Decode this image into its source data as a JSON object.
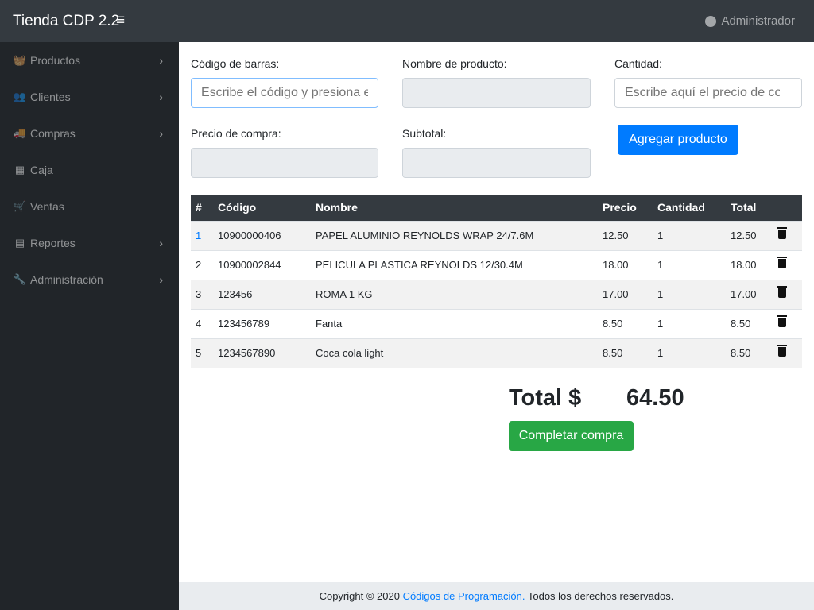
{
  "navbar": {
    "brand": "Tienda CDP 2.2",
    "menu_icon": "≡",
    "user": "Administrador"
  },
  "sidebar": {
    "items": [
      {
        "label": "Productos",
        "icon": "🧺",
        "chevron": true
      },
      {
        "label": "Clientes",
        "icon": "👥",
        "chevron": true
      },
      {
        "label": "Compras",
        "icon": "🚚",
        "chevron": true
      },
      {
        "label": "Caja",
        "icon": "▦",
        "chevron": false
      },
      {
        "label": "Ventas",
        "icon": "🛒",
        "chevron": false
      },
      {
        "label": "Reportes",
        "icon": "▤",
        "chevron": true
      },
      {
        "label": "Administración",
        "icon": "🔧",
        "chevron": true
      }
    ]
  },
  "form": {
    "barcode_label": "Código de barras:",
    "barcode_placeholder": "Escribe el código y presiona enter",
    "name_label": "Nombre de producto:",
    "qty_label": "Cantidad:",
    "qty_placeholder": "Escribe aquí el precio de compra",
    "price_label": "Precio de compra:",
    "subtotal_label": "Subtotal:",
    "add_button": "Agregar producto"
  },
  "table": {
    "headers": [
      "#",
      "Código",
      "Nombre",
      "Precio",
      "Cantidad",
      "Total"
    ],
    "rows": [
      [
        "1",
        "10900000406",
        "PAPEL ALUMINIO REYNOLDS WRAP 24/7.6M",
        "12.50",
        "1",
        "12.50"
      ],
      [
        "2",
        "10900002844",
        "PELICULA PLASTICA REYNOLDS 12/30.4M",
        "18.00",
        "1",
        "18.00"
      ],
      [
        "3",
        "123456",
        "ROMA 1 KG",
        "17.00",
        "1",
        "17.00"
      ],
      [
        "4",
        "123456789",
        "Fanta",
        "8.50",
        "1",
        "8.50"
      ],
      [
        "5",
        "1234567890",
        "Coca cola light",
        "8.50",
        "1",
        "8.50"
      ]
    ]
  },
  "total": {
    "label": "Total $",
    "value": "64.50",
    "complete_button": "Completar compra"
  },
  "footer": {
    "prefix": "Copyright © 2020 ",
    "link": "Códigos de Programación.",
    "suffix": " Todos los derechos reservados."
  }
}
